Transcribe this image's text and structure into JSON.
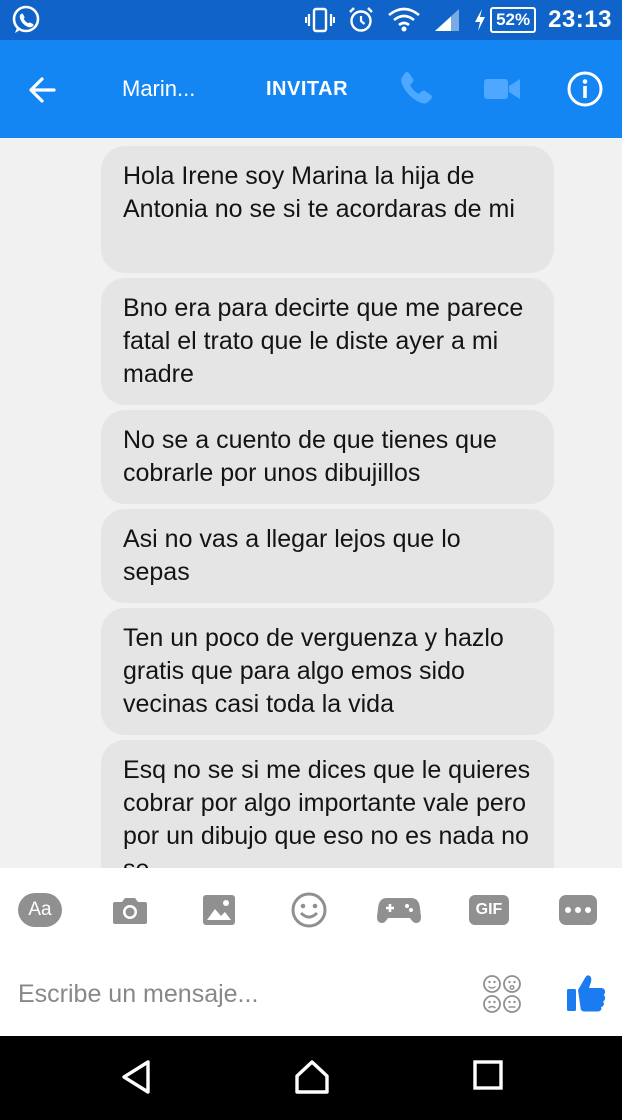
{
  "status_bar": {
    "app_icon": "whatsapp-icon",
    "icons": [
      "vibrate-icon",
      "alarm-icon",
      "wifi-icon",
      "signal-icon",
      "charging-icon"
    ],
    "battery": "52%",
    "time": "23:13"
  },
  "header": {
    "back_icon": "arrow-left-icon",
    "title": "Marin...",
    "invite_label": "INVITAR",
    "actions": [
      "phone-icon",
      "video-camera-icon",
      "info-icon"
    ]
  },
  "messages": [
    {
      "text": "Hola Irene soy Marina la hija de Antonia no se si te acordaras de mi"
    },
    {
      "text": "Bno era para decirte que me parece fatal el trato que le diste ayer a mi madre"
    },
    {
      "text": "No se a cuento de que tienes que cobrarle por unos dibujillos"
    },
    {
      "text": "Asi no vas a llegar lejos que lo sepas"
    },
    {
      "text": "Ten un poco de verguenza y hazlo gratis que para algo emos sido vecinas casi toda la vida"
    },
    {
      "text": "Esq no se si me dices que le quieres cobrar por algo importante vale pero por un dibujo que eso no es nada no se"
    }
  ],
  "composer": {
    "toolbar": {
      "aa_label": "Aa",
      "gif_label": "GIF",
      "icons": [
        "text-style-icon",
        "camera-icon",
        "image-icon",
        "emoji-icon",
        "gamepad-icon",
        "gif-icon",
        "more-icon"
      ]
    },
    "placeholder": "Escribe un mensaje...",
    "right_icons": [
      "emoji-picker-icon",
      "thumbs-up-icon"
    ]
  },
  "nav_bar": {
    "icons": [
      "back-triangle-icon",
      "home-icon",
      "recents-icon"
    ]
  },
  "colors": {
    "status_bar": "#0f63c9",
    "header": "#1486f4",
    "header_icons_muted": "#4fa8ff",
    "bubble": "#e5e5e5",
    "like": "#1a7cf0",
    "toolbar_icons": "#909090"
  }
}
